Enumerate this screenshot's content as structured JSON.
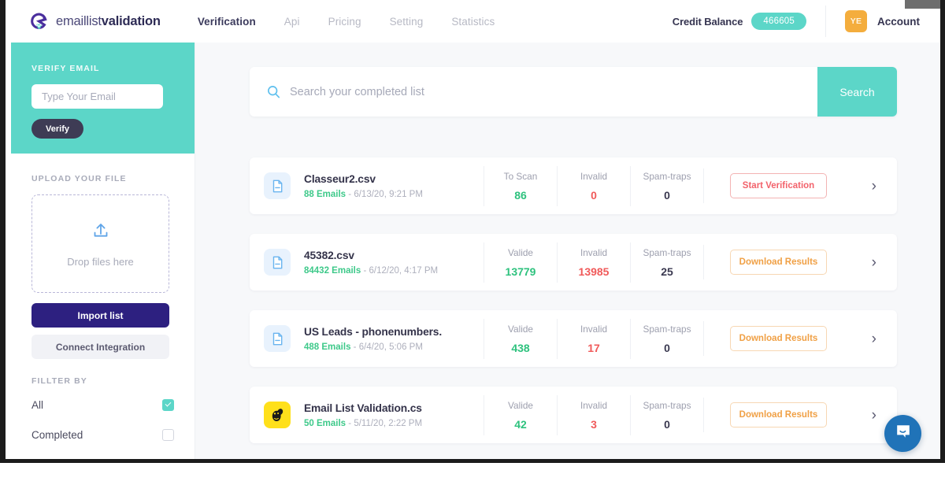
{
  "brand": {
    "thin": "emaillist",
    "bold": "validation",
    "logo_icon": "emaillistvalidation-logo-icon"
  },
  "nav": [
    {
      "label": "Verification",
      "active": true
    },
    {
      "label": "Api",
      "active": false
    },
    {
      "label": "Pricing",
      "active": false
    },
    {
      "label": "Setting",
      "active": false
    },
    {
      "label": "Statistics",
      "active": false
    }
  ],
  "header": {
    "credit_label": "Credit Balance",
    "credit_value": "466605",
    "avatar_initials": "YE",
    "account_label": "Account"
  },
  "sidebar": {
    "verify": {
      "title": "VERIFY EMAIL",
      "input_placeholder": "Type Your Email",
      "input_value": "",
      "button_label": "Verify"
    },
    "upload": {
      "title": "UPLOAD YOUR FILE",
      "dropzone_text": "Drop files here",
      "dropzone_icon": "upload-icon",
      "import_label": "Import list",
      "connect_label": "Connect Integration"
    },
    "filter": {
      "title": "FILLTER BY",
      "items": [
        {
          "label": "All",
          "checked": true
        },
        {
          "label": "Completed",
          "checked": false
        }
      ]
    }
  },
  "search": {
    "icon": "search-icon",
    "placeholder": "Search your completed list",
    "value": "",
    "button_label": "Search"
  },
  "list": {
    "column_labels": {
      "to_scan": "To Scan",
      "valide": "Valide",
      "invalid": "Invalid",
      "spam": "Spam-traps"
    },
    "rows": [
      {
        "icon": "file-document-icon",
        "name": "Classeur2.csv",
        "emails": "88 Emails",
        "separator": "-",
        "date": "6/13/20, 9:21 PM",
        "stat1_label": "To Scan",
        "stat1_value": "86",
        "stat2_label": "Invalid",
        "stat2_value": "0",
        "stat3_label": "Spam-traps",
        "stat3_value": "0",
        "action_label": "Start Verification",
        "action_style": "start",
        "chevron": "chevron-right-icon"
      },
      {
        "icon": "file-document-icon",
        "name": "45382.csv",
        "emails": "84432 Emails",
        "separator": "-",
        "date": "6/12/20, 4:17 PM",
        "stat1_label": "Valide",
        "stat1_value": "13779",
        "stat2_label": "Invalid",
        "stat2_value": "13985",
        "stat3_label": "Spam-traps",
        "stat3_value": "25",
        "action_label": "Download Results",
        "action_style": "dl",
        "chevron": "chevron-right-icon"
      },
      {
        "icon": "file-document-icon",
        "name": "US Leads - phonenumbers.",
        "emails": "488 Emails",
        "separator": "-",
        "date": "6/4/20, 5:06 PM",
        "stat1_label": "Valide",
        "stat1_value": "438",
        "stat2_label": "Invalid",
        "stat2_value": "17",
        "stat3_label": "Spam-traps",
        "stat3_value": "0",
        "action_label": "Download Results",
        "action_style": "dl",
        "chevron": "chevron-right-icon"
      },
      {
        "icon": "mailchimp-icon",
        "name": "Email List Validation.cs",
        "emails": "50 Emails",
        "separator": "-",
        "date": "5/11/20, 2:22 PM",
        "stat1_label": "Valide",
        "stat1_value": "42",
        "stat2_label": "Invalid",
        "stat2_value": "3",
        "stat3_label": "Spam-traps",
        "stat3_value": "0",
        "action_label": "Download Results",
        "action_style": "dl",
        "chevron": "chevron-right-icon"
      }
    ]
  },
  "chat": {
    "icon": "chat-bubble-icon"
  },
  "colors": {
    "teal": "#5cd6c8",
    "indigo": "#2d2080",
    "green": "#2ec27e",
    "red": "#f05a5a",
    "orange": "#f0a045",
    "amber": "#f4ad3d",
    "mailchimp_yellow": "#ffe01b",
    "chat_blue": "#2073b8"
  }
}
